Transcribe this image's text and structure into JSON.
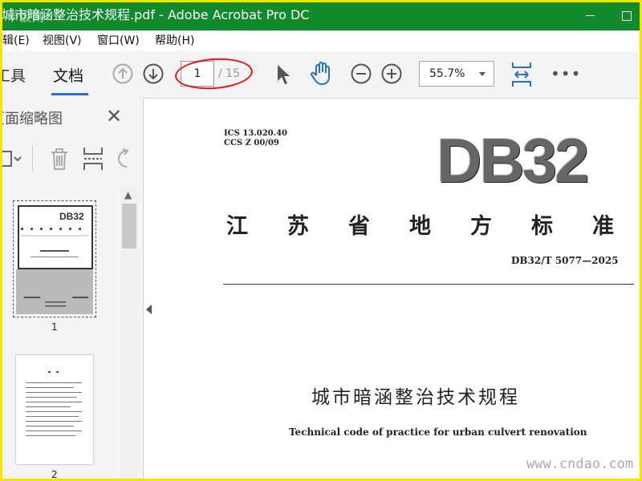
{
  "window": {
    "title": "城市暗涵整治技术规程.pdf - Adobe Acrobat Pro DC",
    "watermark": "卡饭网"
  },
  "menu": {
    "items": [
      "辑(E)",
      "视图(V)",
      "窗口(W)",
      "帮助(H)"
    ]
  },
  "toolbar": {
    "tabs": [
      "工具",
      "文档"
    ],
    "active_tab": "文档",
    "page_current": "1",
    "page_total": "/ 15",
    "zoom": "55.7%",
    "more": "•••"
  },
  "panel": {
    "title": "页面缩略图",
    "thumbnails": [
      {
        "label": "1"
      },
      {
        "label": "2"
      }
    ]
  },
  "document": {
    "ics_line1": "ICS 13.020.40",
    "ics_line2": "CCS Z 00/09",
    "code": "DB32",
    "province_title": "江苏省地方标准",
    "standard_number": "DB32/T 5077—2025",
    "title_cn": "城市暗涵整治技术规程",
    "title_en": "Technical code of practice for urban culvert renovation"
  },
  "site_watermark": "www.cndao.com",
  "colors": {
    "titlebar": "#108a2b",
    "accent": "#2b6fd6",
    "highlight_circle": "#e11111",
    "frame": "#f2e600"
  }
}
